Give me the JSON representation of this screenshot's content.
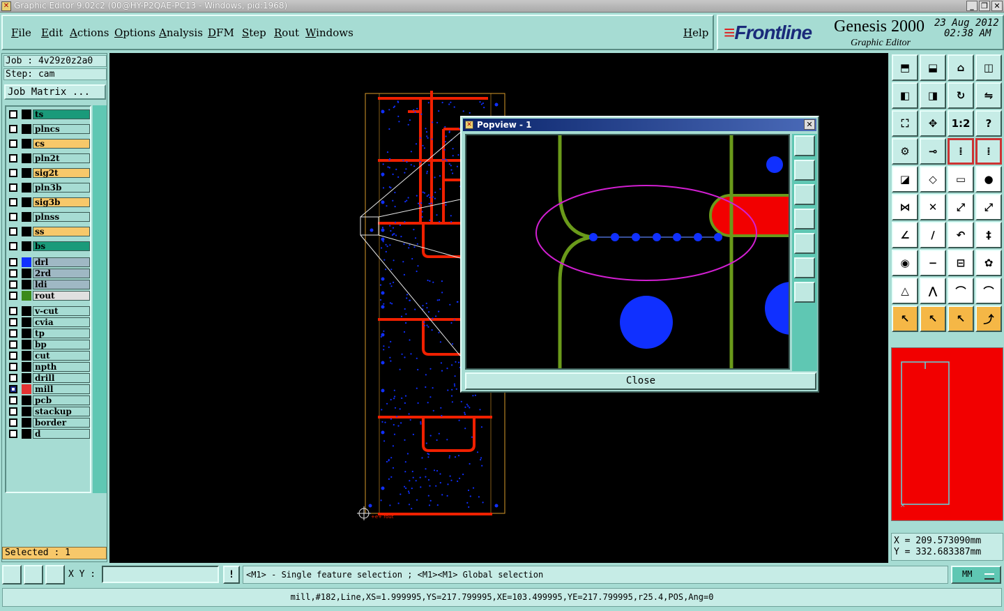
{
  "window": {
    "title": "Graphic Editor 9.02c2 (00@HY-P2QAE-PC13 - Windows, pid:1968)",
    "minimize_icon": "minimize-icon",
    "restore_icon": "restore-icon",
    "close_icon": "close-icon"
  },
  "menu": {
    "file": "File",
    "edit": "Edit",
    "actions": "Actions",
    "options": "Options",
    "analysis": "Analysis",
    "dfm": "DFM",
    "step": "Step",
    "rout": "Rout",
    "windows": "Windows",
    "help": "Help"
  },
  "brand": {
    "logo": "Frontline",
    "product": "Genesis 2000",
    "subtitle": "Graphic Editor",
    "date": "23 Aug 2012",
    "time": "02:38 AM"
  },
  "job": {
    "job_line": "Job : 4v29z0z2a0",
    "step_line": "Step: cam",
    "matrix_button": "Job Matrix ..."
  },
  "layers": [
    {
      "name": "ts",
      "color": "#1a9a7a",
      "checked": false,
      "swatch": "#000000"
    },
    {
      "name": "plncs",
      "color": "#a6dcd3",
      "checked": false,
      "swatch": "#000000"
    },
    {
      "name": "cs",
      "color": "#f7c86a",
      "checked": false,
      "swatch": "#000000"
    },
    {
      "name": "pln2t",
      "color": "#a6dcd3",
      "checked": false,
      "swatch": "#000000"
    },
    {
      "name": "sig2t",
      "color": "#f7c86a",
      "checked": false,
      "swatch": "#000000"
    },
    {
      "name": "pln3b",
      "color": "#a6dcd3",
      "checked": false,
      "swatch": "#000000"
    },
    {
      "name": "sig3b",
      "color": "#f7c86a",
      "checked": false,
      "swatch": "#000000"
    },
    {
      "name": "plnss",
      "color": "#a6dcd3",
      "checked": false,
      "swatch": "#000000"
    },
    {
      "name": "ss",
      "color": "#f7c86a",
      "checked": false,
      "swatch": "#000000"
    },
    {
      "name": "bs",
      "color": "#1a9a7a",
      "checked": false,
      "swatch": "#000000"
    },
    {
      "name": "drl",
      "color": "#9fb8c4",
      "checked": false,
      "swatch": "#1030ff"
    },
    {
      "name": "2rd",
      "color": "#9fb8c4",
      "checked": false,
      "swatch": "#000000"
    },
    {
      "name": "ldi",
      "color": "#9fb8c4",
      "checked": false,
      "swatch": "#000000"
    },
    {
      "name": "rout",
      "color": "#e0e0e0",
      "checked": false,
      "swatch": "#3a8a1a"
    },
    {
      "name": "v-cut",
      "color": "#a6dcd3",
      "checked": false,
      "swatch": "#000000"
    },
    {
      "name": "cvia",
      "color": "#a6dcd3",
      "checked": false,
      "swatch": "#000000"
    },
    {
      "name": "tp",
      "color": "#a6dcd3",
      "checked": false,
      "swatch": "#000000"
    },
    {
      "name": "bp",
      "color": "#a6dcd3",
      "checked": false,
      "swatch": "#000000"
    },
    {
      "name": "cut",
      "color": "#a6dcd3",
      "checked": false,
      "swatch": "#000000"
    },
    {
      "name": "npth",
      "color": "#a6dcd3",
      "checked": false,
      "swatch": "#000000"
    },
    {
      "name": "drill",
      "color": "#a6dcd3",
      "checked": false,
      "swatch": "#000000"
    },
    {
      "name": "mill",
      "color": "#a6dcd3",
      "checked": true,
      "swatch": "#e33333"
    },
    {
      "name": "pcb",
      "color": "#a6dcd3",
      "checked": false,
      "swatch": "#000000"
    },
    {
      "name": "stackup",
      "color": "#a6dcd3",
      "checked": false,
      "swatch": "#000000"
    },
    {
      "name": "border",
      "color": "#a6dcd3",
      "checked": false,
      "swatch": "#000000"
    },
    {
      "name": "d",
      "color": "#a6dcd3",
      "checked": false,
      "swatch": "#000000"
    }
  ],
  "selected": "Selected : 1",
  "canvas": {
    "origin_label": "+e+ rout"
  },
  "popview": {
    "title": "Popview - 1",
    "close_label": "Close"
  },
  "coords": {
    "x": "X = 209.573090mm",
    "y": "Y = 332.683387mm"
  },
  "bottom": {
    "xy_label": "X Y :",
    "xy_value": "",
    "info_label": "!",
    "hint": "<M1> - Single feature selection ; <M1><M1> Global selection",
    "units": "MM"
  },
  "status": "mill,#182,Line,XS=1.999995,YS=217.799995,XE=103.499995,YE=217.799995,r25.4,POS,Ang=0",
  "colors": {
    "accent": "#a6dcd3",
    "trace": "#f20000",
    "drill": "#1030ff",
    "rout": "#6a9a1a",
    "highlight": "#d21fd2"
  }
}
